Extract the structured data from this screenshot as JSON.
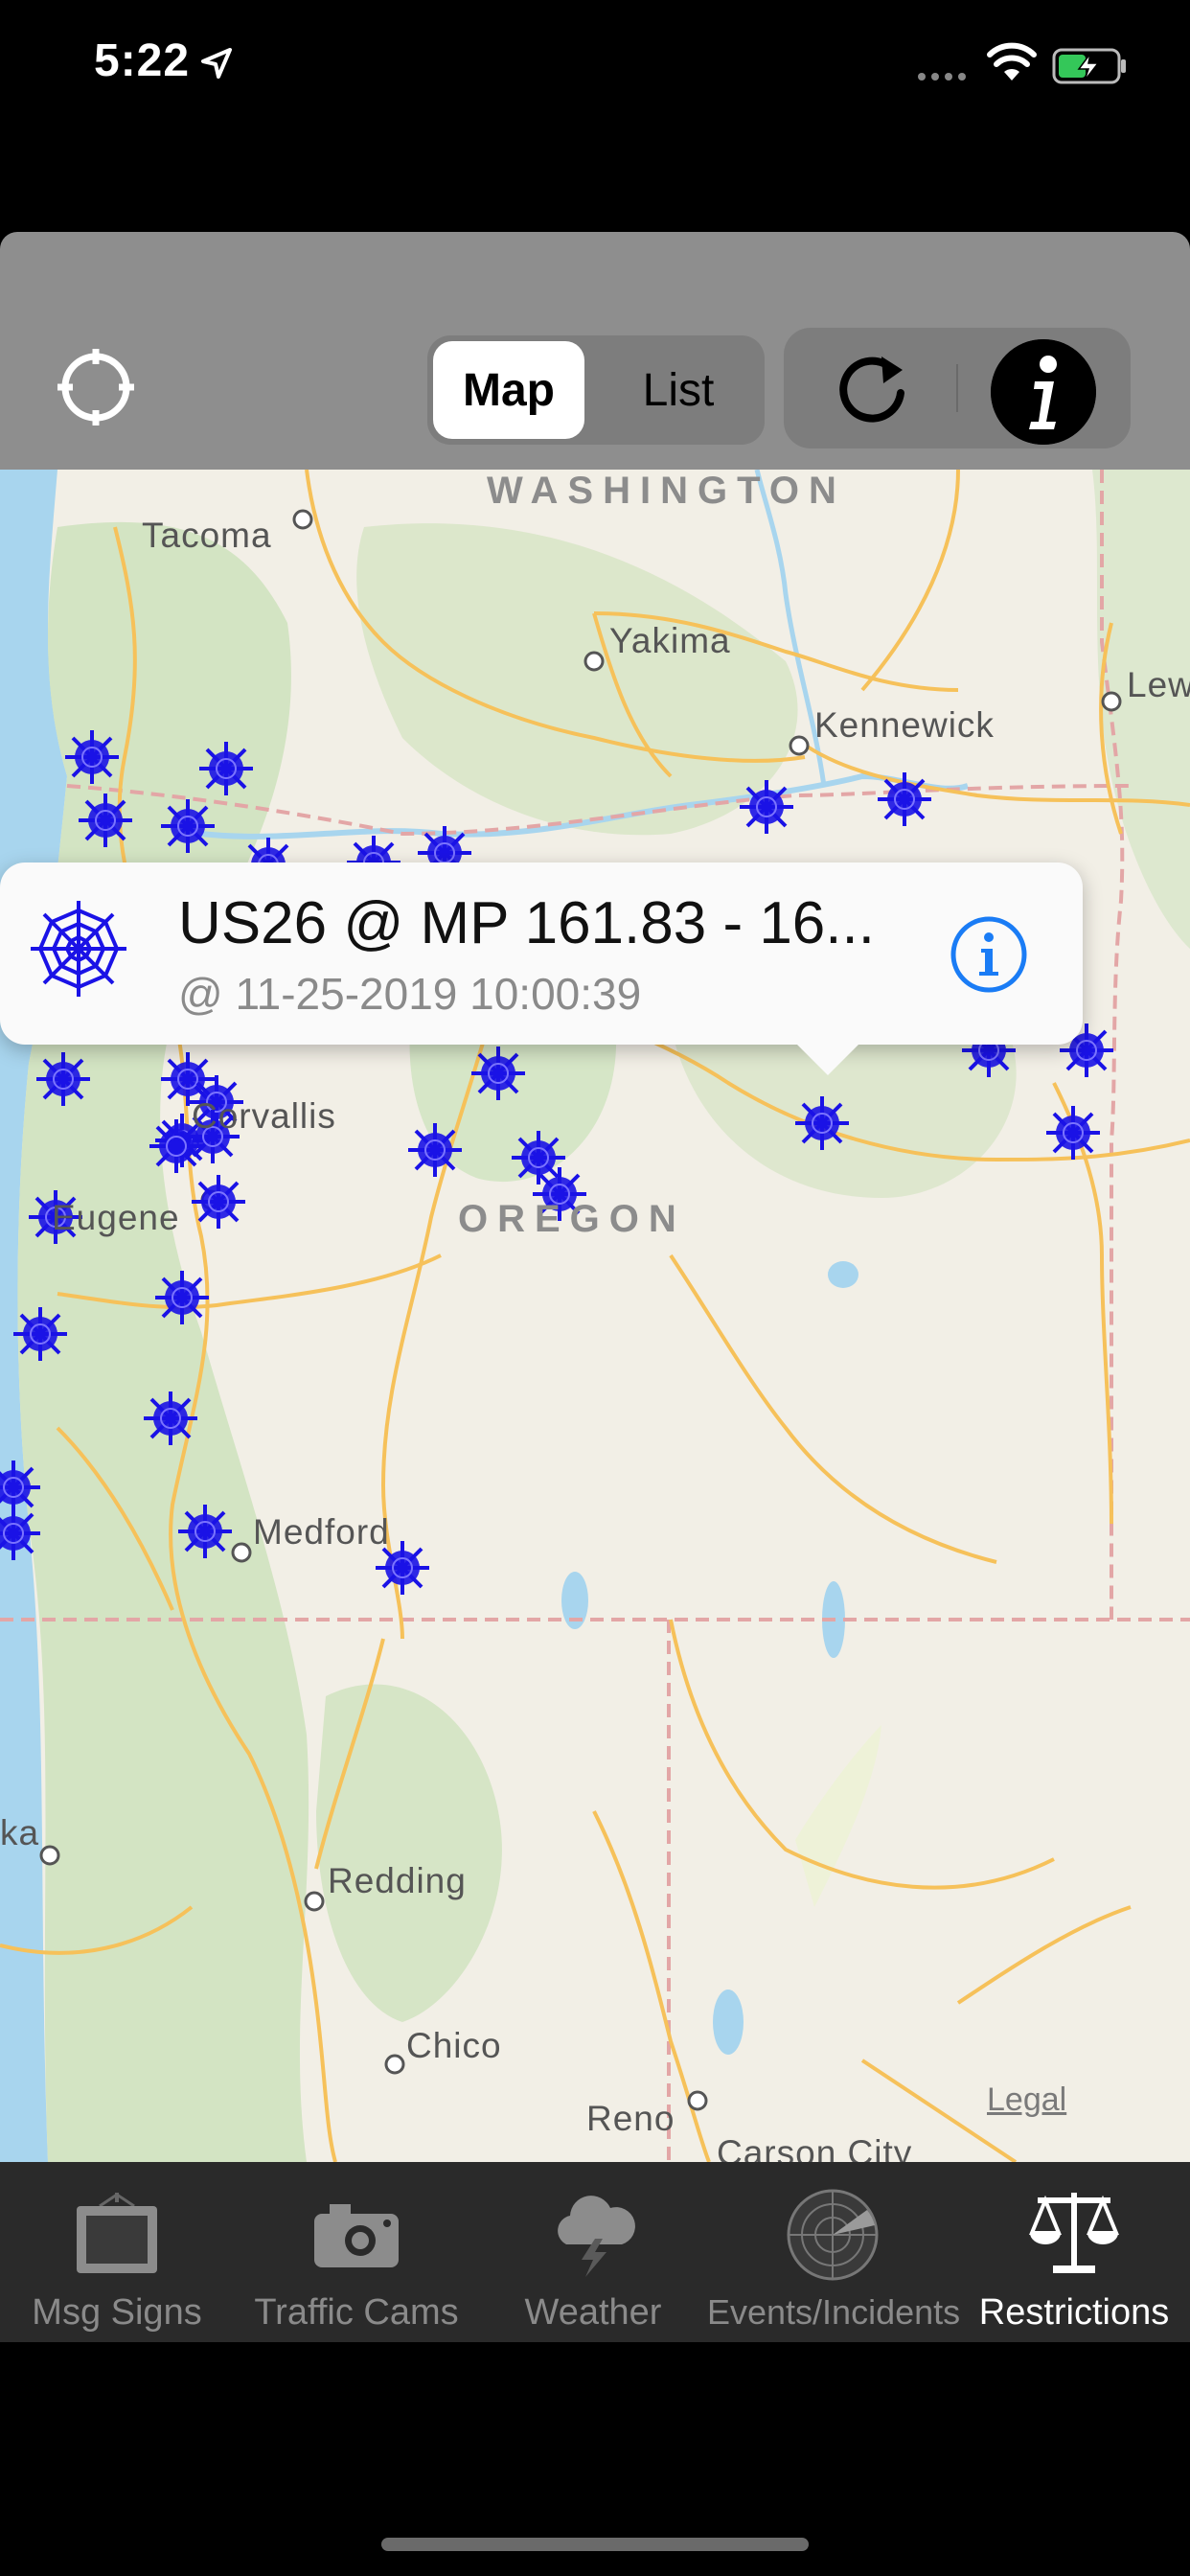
{
  "status_bar": {
    "time": "5:22"
  },
  "toolbar": {
    "segment_map": "Map",
    "segment_list": "List",
    "selected_segment": "Map"
  },
  "map": {
    "state_labels": [
      "WASHINGTON",
      "OREGON"
    ],
    "cities": [
      "Tacoma",
      "Yakima",
      "Kennewick",
      "Lew",
      "Corvallis",
      "Eugene",
      "Medford",
      "Redding",
      "Chico",
      "Reno",
      "Carson City",
      "ka"
    ],
    "legal": "Legal"
  },
  "callout": {
    "title": "US26 @ MP 161.83 - 16...",
    "subtitle": "@ 11-25-2019 10:00:39"
  },
  "tabbar": {
    "items": [
      {
        "label": "Msg Signs",
        "icon": "message-sign-icon"
      },
      {
        "label": "Traffic Cams",
        "icon": "camera-icon"
      },
      {
        "label": "Weather",
        "icon": "storm-cloud-icon"
      },
      {
        "label": "Events/Incidents",
        "icon": "radar-icon"
      },
      {
        "label": "Restrictions",
        "icon": "scales-icon"
      }
    ],
    "selected": "Restrictions"
  },
  "colors": {
    "marker": "#1a12e6",
    "accent": "#1a7cf5",
    "toolbar": "#8e8e8e",
    "tabbar": "#2a2a2a"
  }
}
